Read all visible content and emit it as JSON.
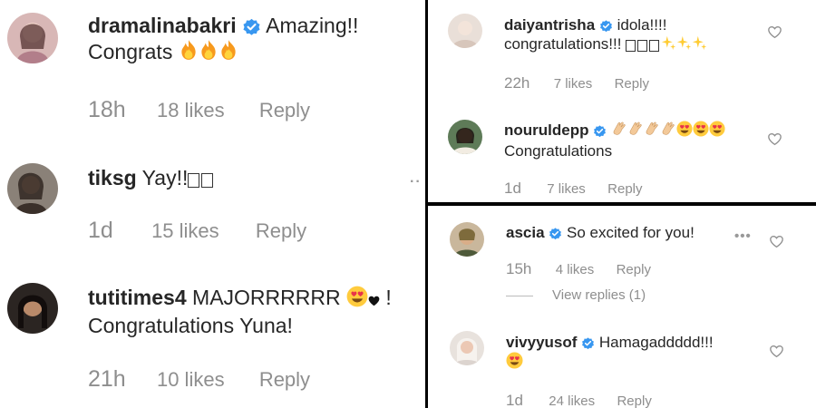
{
  "colors": {
    "text": "#262626",
    "meta": "#8e8e8e",
    "verified": "#3897f0",
    "divider": "#000000"
  },
  "left_panel": {
    "comments": [
      {
        "username": "dramalinabakri",
        "verified": true,
        "text": "Amazing!!",
        "line2": "Congrats",
        "emoji": "fire-emoji x3",
        "time": "18h",
        "likes": "18 likes",
        "reply": "Reply"
      },
      {
        "username": "tiksg",
        "verified": false,
        "text": "Yay!!",
        "emoji": "unrendered-glyph x2",
        "time": "1d",
        "likes": "15 likes",
        "reply": "Reply"
      },
      {
        "username": "tutitimes4",
        "verified": false,
        "text": "MAJORRRRRR",
        "trail": "!",
        "line2": "Congratulations Yuna!",
        "emoji": "heart-eyes + black-heart",
        "time": "21h",
        "likes": "10 likes",
        "reply": "Reply"
      }
    ]
  },
  "right_top_panel": {
    "comments": [
      {
        "username": "daiyantrisha",
        "verified": true,
        "text": "idola!!!!",
        "line2": "congratulations!!!",
        "emoji": "unrendered-glyph x3 + sparkles x3",
        "time": "22h",
        "likes": "7 likes",
        "reply": "Reply"
      },
      {
        "username": "nouruldepp",
        "verified": true,
        "text": "",
        "line2": "Congratulations",
        "emoji": "clapping-hands x4 + heart-eyes x3",
        "time": "1d",
        "likes": "7 likes",
        "reply": "Reply"
      }
    ]
  },
  "right_bottom_panel": {
    "comments": [
      {
        "username": "ascia",
        "verified": true,
        "text": "So excited for you!",
        "time": "15h",
        "likes": "4 likes",
        "reply": "Reply",
        "view_replies": "View replies (1)"
      },
      {
        "username": "vivyyusof",
        "verified": true,
        "text": "Hamagaddddd!!!",
        "emoji": "heart-eyes",
        "time": "1d",
        "likes": "24 likes",
        "reply": "Reply"
      }
    ]
  }
}
